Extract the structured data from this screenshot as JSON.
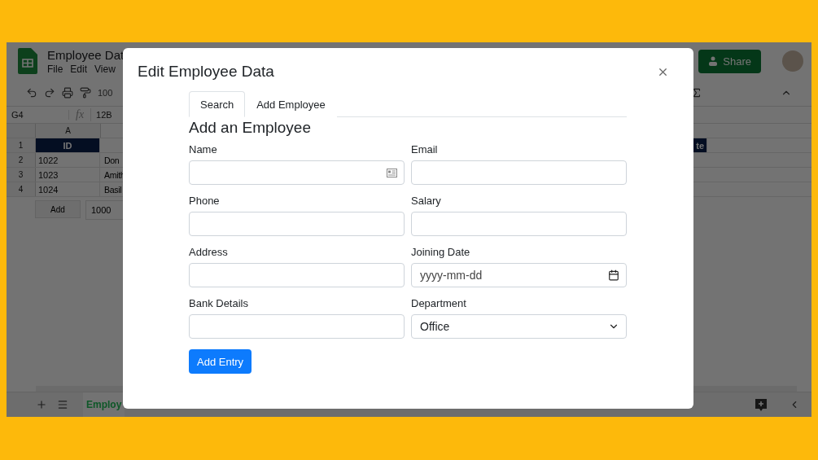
{
  "spreadsheet": {
    "title": "Employee Dat",
    "menu": [
      "File",
      "Edit",
      "View"
    ],
    "zoom": "100",
    "share_button": "Share",
    "cell_ref": "G4",
    "formula_icon": "fx",
    "formula": "12B",
    "column_header": "A",
    "rows": [
      {
        "number": "1",
        "kind": "header",
        "a": "ID",
        "end": "te"
      },
      {
        "number": "2",
        "kind": "data",
        "a": "1022",
        "b": "Don"
      },
      {
        "number": "3",
        "kind": "data",
        "a": "1023",
        "b": "Amith"
      },
      {
        "number": "4",
        "kind": "data",
        "a": "1024",
        "b": "Basil"
      }
    ],
    "add_button": "Add",
    "add_count": "1000",
    "sheet_tab": "Employ"
  },
  "dialog": {
    "title": "Edit Employee Data",
    "tabs": [
      {
        "label": "Search",
        "selected": true
      },
      {
        "label": "Add Employee",
        "selected": false
      }
    ],
    "heading": "Add an Employee",
    "fields": [
      {
        "label": "Name",
        "kind": "text",
        "autofill": true
      },
      {
        "label": "Email",
        "kind": "text",
        "autofill": false
      },
      {
        "label": "Phone",
        "kind": "text",
        "autofill": false
      },
      {
        "label": "Salary",
        "kind": "text",
        "autofill": false
      },
      {
        "label": "Address",
        "kind": "text",
        "autofill": false
      },
      {
        "label": "Joining Date",
        "kind": "date",
        "placeholder": "yyyy-mm-dd"
      },
      {
        "label": "Bank Details",
        "kind": "text",
        "autofill": false
      },
      {
        "label": "Department",
        "kind": "select",
        "value": "Office"
      }
    ],
    "submit_button": "Add Entry"
  }
}
